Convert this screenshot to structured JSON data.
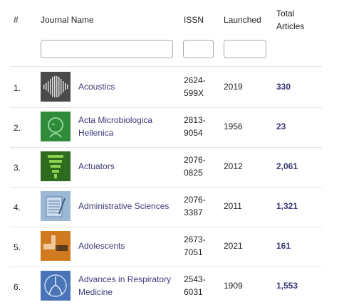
{
  "header": {
    "index": "#",
    "journal_name": "Journal Name",
    "issn": "ISSN",
    "launched": "Launched",
    "total_line1": "Total",
    "total_line2": "Articles"
  },
  "filters": {
    "journal_name": "",
    "issn": "",
    "launched": ""
  },
  "rows": [
    {
      "num": "1.",
      "name_lines": [
        "Acoustics"
      ],
      "issn_lines": [
        "2624-",
        "599X"
      ],
      "launched": "2019",
      "total": "330"
    },
    {
      "num": "2.",
      "name_lines": [
        "Acta Microbiologica",
        "Hellenica"
      ],
      "issn_lines": [
        "2813-",
        "9054"
      ],
      "launched": "1956",
      "total": "23"
    },
    {
      "num": "3.",
      "name_lines": [
        "Actuators"
      ],
      "issn_lines": [
        "2076-",
        "0825"
      ],
      "launched": "2012",
      "total": "2,061"
    },
    {
      "num": "4.",
      "name_lines": [
        "Administrative Sciences"
      ],
      "issn_lines": [
        "2076-",
        "3387"
      ],
      "launched": "2011",
      "total": "1,321"
    },
    {
      "num": "5.",
      "name_lines": [
        "Adolescents"
      ],
      "issn_lines": [
        "2673-",
        "7051"
      ],
      "launched": "2021",
      "total": "161"
    },
    {
      "num": "6.",
      "name_lines": [
        "Advances in Respiratory",
        "Medicine"
      ],
      "issn_lines": [
        "2543-",
        "6031"
      ],
      "launched": "1909",
      "total": "1,553"
    }
  ],
  "colors": {
    "link": "#3b3b7a",
    "acoustics_bg": "#4a4a4a",
    "microbio_bg": "#2f8a3a",
    "actuators_bg": "#2f6b1f",
    "admin_bg": "#9cb8d4",
    "adolescents_bg": "#d07a1f",
    "respiratory_bg": "#4a74b8"
  }
}
